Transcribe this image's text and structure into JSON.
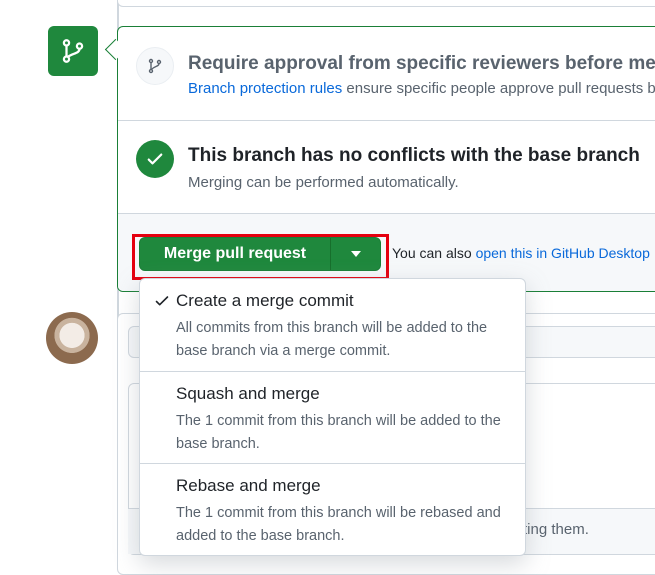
{
  "merge_box": {
    "review_title": "Require approval from specific reviewers before merging",
    "review_link": "Branch protection rules",
    "review_rest": " ensure specific people approve pull requests before they're merged.",
    "conflict_title": "This branch has no conflicts with the base branch",
    "conflict_sub": "Merging can be performed automatically.",
    "merge_button_label": "Merge pull request",
    "also_prefix": "You can also ",
    "also_link": "open this in GitHub Desktop"
  },
  "merge_menu": {
    "options": [
      {
        "title": "Create a merge commit",
        "description": "All commits from this branch will be added to the base branch via a merge commit.",
        "selected": true
      },
      {
        "title": "Squash and merge",
        "description": "The 1 commit from this branch will be added to the base branch.",
        "selected": false
      },
      {
        "title": "Rebase and merge",
        "description": "The 1 commit from this branch will be rebased and added to the base branch.",
        "selected": false
      }
    ]
  },
  "background": {
    "partial_text": "ting them."
  },
  "colors": {
    "primary_green": "#1f883d",
    "link_blue": "#0969da",
    "highlight_red": "#e5000f"
  }
}
